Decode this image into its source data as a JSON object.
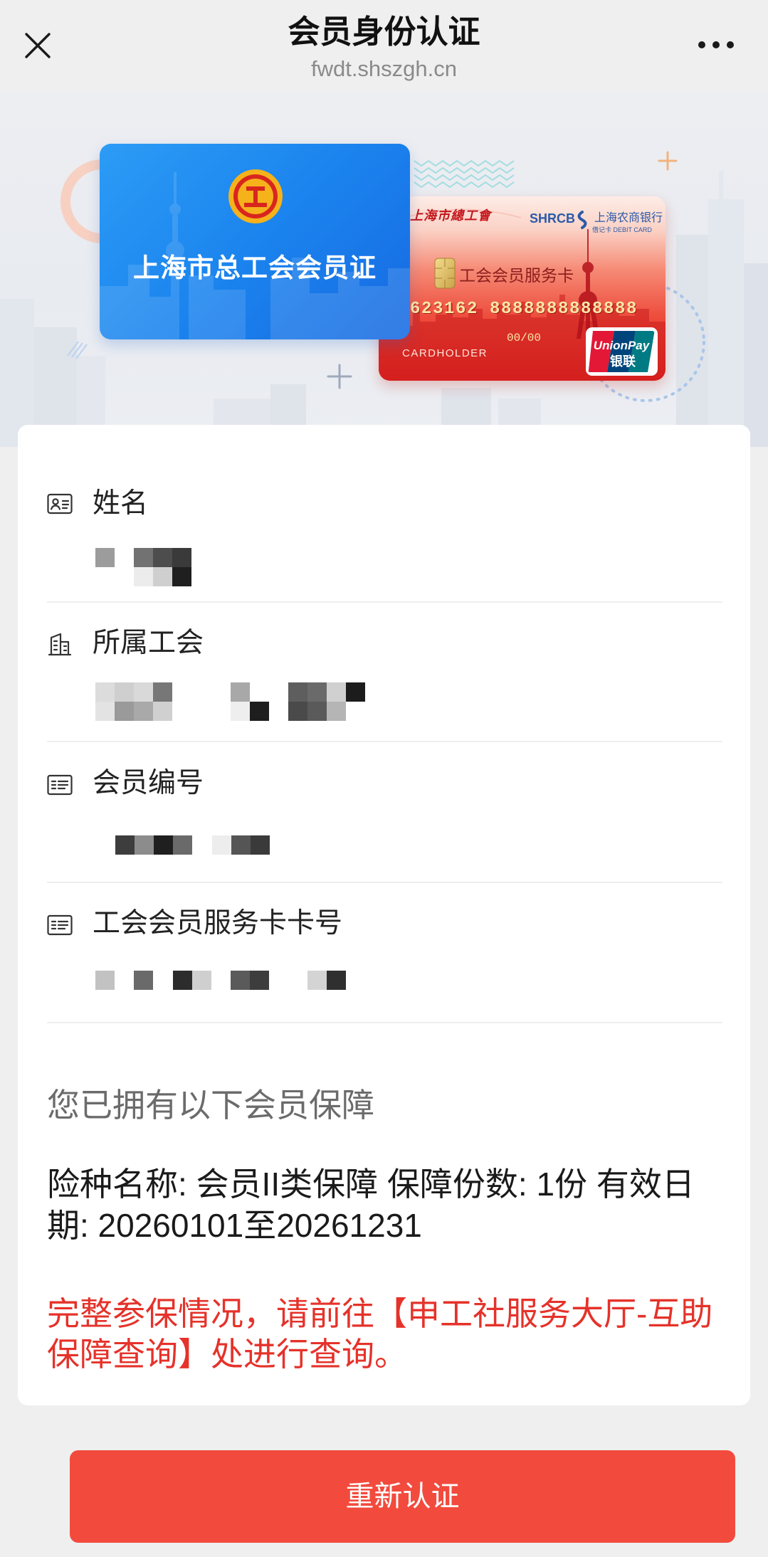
{
  "header": {
    "title": "会员身份认证",
    "url": "fwdt.shszgh.cn",
    "close_icon": "close-icon",
    "more_icon": "more-icon"
  },
  "banner": {
    "member_card": {
      "title": "上海市总工会会员证",
      "logo_icon": "union-emblem-icon"
    },
    "service_card": {
      "issuer": "上海市總工會",
      "bank_code": "SHRCB",
      "bank_name": "上海农商银行",
      "card_kind": "借记卡 DEBIT CARD",
      "title": "工会会员服务卡",
      "number": "623162 8888888888888",
      "expiry": "00/00",
      "holder": "CARDHOLDER",
      "network_en": "UnionPay",
      "network_cn": "银联",
      "chip_icon": "chip-icon"
    }
  },
  "fields": [
    {
      "label": "姓名",
      "icon": "id-card-icon"
    },
    {
      "label": "所属工会",
      "icon": "building-icon"
    },
    {
      "label": "会员编号",
      "icon": "card-icon"
    },
    {
      "label": "工会会员服务卡卡号",
      "icon": "card-icon"
    }
  ],
  "coverage": {
    "heading": "您已拥有以下会员保障",
    "detail": "险种名称: 会员II类保障 保障份数: 1份 有效日期: 20260101至20261231",
    "notice": "完整参保情况，请前往【申工社服务大厅-互助保障查询】处进行查询。"
  },
  "actions": {
    "reauth_label": "重新认证"
  },
  "colors": {
    "page_bg": "#efefef",
    "primary_button": "#f24b3e",
    "notice_text": "#e5322a",
    "member_card_blue": "#1b84ee",
    "service_card_red": "#e3221f"
  }
}
